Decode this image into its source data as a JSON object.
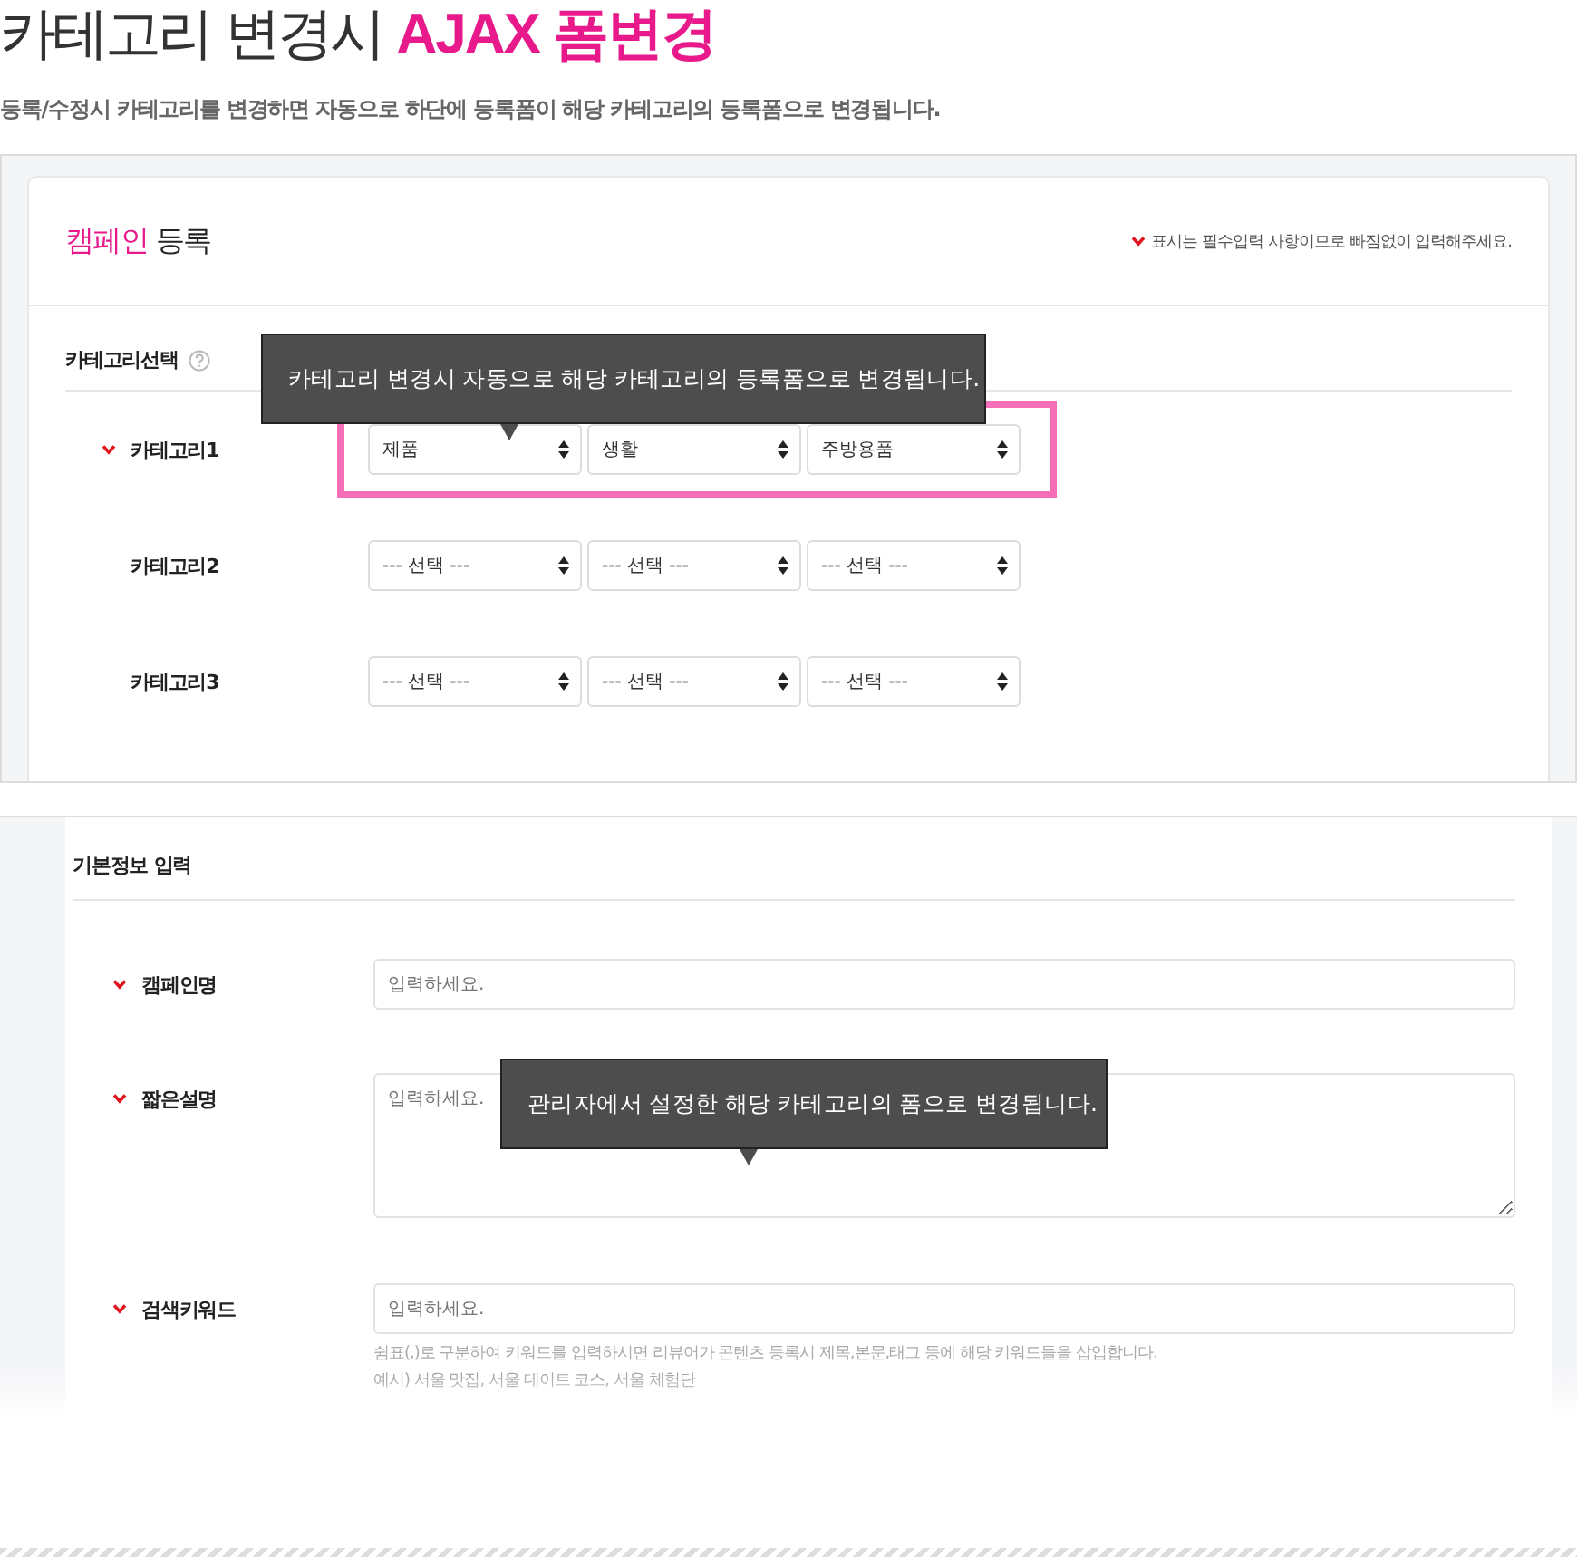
{
  "title": {
    "text": "카테고리 변경시 ",
    "highlight": "AJAX 폼변경"
  },
  "subtitle": "등록/수정시 카테고리를 변경하면 자동으로 하단에 등록폼이 해당 카테고리의 등록폼으로 변경됩니다.",
  "card": {
    "title_highlight": "캠페인",
    "title": " 등록",
    "required_note": "표시는 필수입력 사항이므로 빠짐없이 입력해주세요."
  },
  "category_section": {
    "title": "카테고리선택",
    "tooltip": "카테고리 변경시 자동으로 해당 카테고리의 등록폼으로 변경됩니다.",
    "rows": [
      {
        "label": "카테고리1",
        "required": true,
        "highlighted": true,
        "selects": [
          "제품",
          "생활",
          "주방용품"
        ]
      },
      {
        "label": "카테고리2",
        "required": false,
        "highlighted": false,
        "selects": [
          "--- 선택 ---",
          "--- 선택 ---",
          "--- 선택 ---"
        ]
      },
      {
        "label": "카테고리3",
        "required": false,
        "highlighted": false,
        "selects": [
          "--- 선택 ---",
          "--- 선택 ---",
          "--- 선택 ---"
        ]
      }
    ]
  },
  "basic_section": {
    "title": "기본정보 입력",
    "tooltip": "관리자에서 설정한 해당 카테고리의 폼으로 변경됩니다.",
    "fields": [
      {
        "label": "캠페인명",
        "required": true,
        "kind": "input",
        "placeholder": "입력하세요."
      },
      {
        "label": "짧은설명",
        "required": true,
        "kind": "textarea",
        "placeholder": "입력하세요."
      },
      {
        "label": "검색키워드",
        "required": true,
        "kind": "input",
        "placeholder": "입력하세요.",
        "help": [
          "쉼표(,)로 구분하여 키워드를 입력하시면 리뷰어가 콘텐츠 등록시 제목,본문,태그 등에 해당 키워드들을 삽입합니다.",
          "예시) 서울 맛집, 서울 데이트 코스, 서울 체험단"
        ]
      }
    ]
  }
}
